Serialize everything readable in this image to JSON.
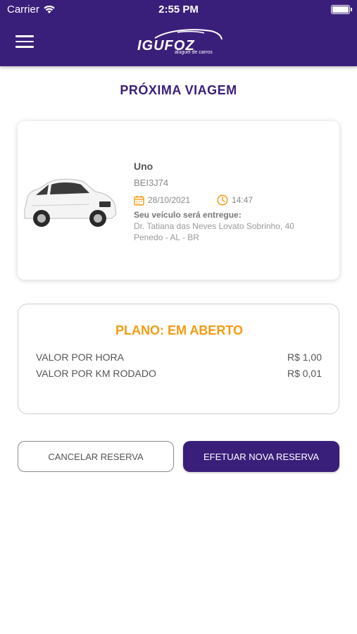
{
  "status_bar": {
    "carrier": "Carrier",
    "time": "2:55 PM"
  },
  "header": {
    "brand": "IGUFOZ",
    "tagline": "aluguel de carros",
    "bg_color": "#3a1f7a"
  },
  "page": {
    "title": "PRÓXIMA VIAGEM"
  },
  "trip": {
    "model": "Uno",
    "plate": "BEI3J74",
    "date": "28/10/2021",
    "time": "14:47",
    "delivery_label": "Seu veículo será entregue:",
    "address_line1": "Dr. Tatiana das Neves Lovato Sobrinho, 40",
    "address_line2": "Penedo - AL - BR"
  },
  "plan": {
    "title": "PLANO: EM ABERTO",
    "rows": [
      {
        "label": "VALOR POR HORA",
        "value": "R$ 1,00"
      },
      {
        "label": "VALOR POR KM RODADO",
        "value": "R$ 0,01"
      }
    ]
  },
  "actions": {
    "cancel_label": "CANCELAR RESERVA",
    "new_label": "EFETUAR NOVA RESERVA"
  },
  "colors": {
    "primary": "#3a1f7a",
    "accent": "#f39c12"
  }
}
